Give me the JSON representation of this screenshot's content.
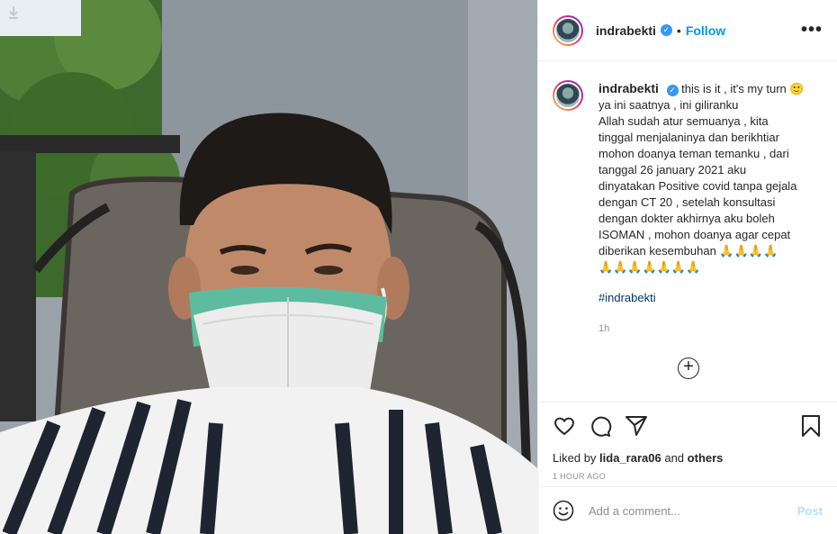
{
  "post": {
    "username": "indrabekti",
    "follow_label": "Follow",
    "separator": "•",
    "more_label": "•••"
  },
  "caption": {
    "username": "indrabekti",
    "lines": [
      "this is it , it's my turn 🙂",
      "ya ini saatnya , ini giliranku",
      "Allah sudah atur semuanya , kita",
      "tinggal menjalaninya dan berikhtiar",
      "mohon doanya teman temanku , dari",
      "tanggal 26 january 2021 aku",
      "dinyatakan Positive covid tanpa gejala",
      "dengan CT 20 , setelah konsultasi",
      "dengan dokter akhirnya aku boleh",
      "ISOMAN , mohon doanya agar cepat",
      "diberikan kesembuhan 🙏🙏🙏🙏",
      "🙏🙏🙏🙏🙏🙏🙏"
    ],
    "hashtag": "#indrabekti",
    "time": "1h"
  },
  "actions": {
    "liked_prefix": "Liked by",
    "liked_user": "lida_rara06",
    "liked_and": "and",
    "liked_others": "others",
    "timestamp": "1 HOUR AGO"
  },
  "comment": {
    "placeholder": "Add a comment...",
    "post_label": "Post"
  },
  "icons": {
    "download": "download-arrow-icon",
    "verified": "verified-badge-icon",
    "like": "heart-icon",
    "comment": "comment-bubble-icon",
    "share": "paper-plane-icon",
    "save": "bookmark-icon",
    "emoji": "smiley-icon",
    "more_comments": "plus-circle-icon"
  },
  "colors": {
    "link_blue": "#0095f6",
    "hashtag": "#00376b",
    "muted": "#8e8e8e",
    "post_disabled": "#b2dffc"
  }
}
